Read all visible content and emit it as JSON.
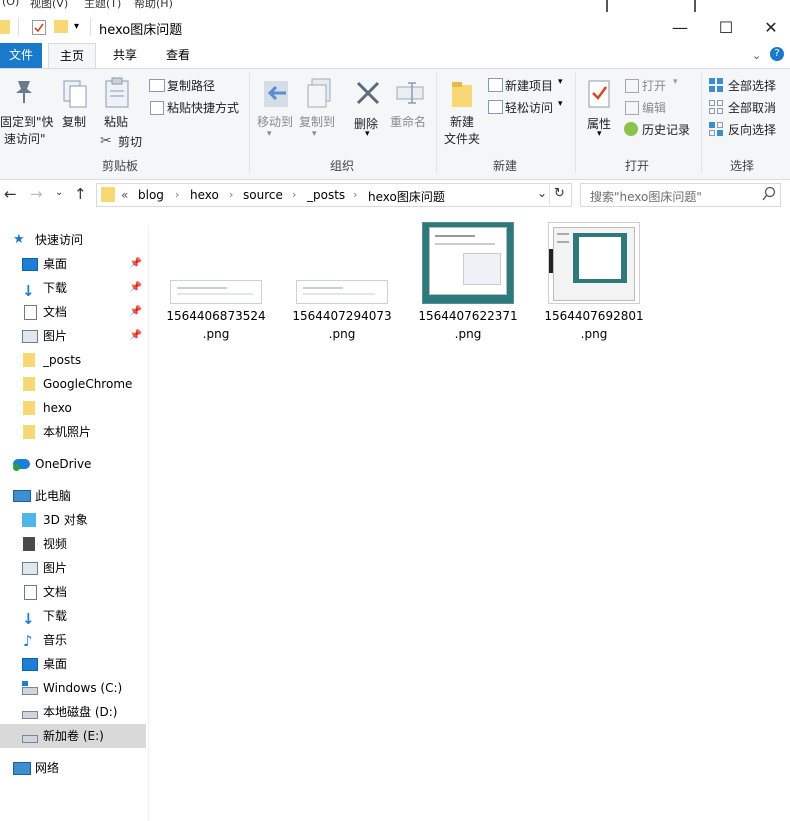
{
  "background_menu": {
    "items": [
      "(O)",
      "视图(V)",
      "主题(T)",
      "帮助(H)"
    ]
  },
  "title": "hexo图床问题",
  "window_buttons": {
    "minimize": "—",
    "maximize": "☐",
    "close": "✕"
  },
  "tabs": [
    "文件",
    "主页",
    "共享",
    "查看"
  ],
  "ribbon": {
    "clipboard": {
      "pin_label_1": "固定到\"快",
      "pin_label_2": "速访问\"",
      "copy": "复制",
      "paste": "粘贴",
      "copy_path": "复制路径",
      "paste_shortcut": "粘贴快捷方式",
      "cut": "剪切",
      "group": "剪贴板"
    },
    "organize": {
      "move_to": "移动到",
      "copy_to": "复制到",
      "delete": "删除",
      "rename": "重命名",
      "group": "组织"
    },
    "new": {
      "new_folder_1": "新建",
      "new_folder_2": "文件夹",
      "new_item": "新建项目",
      "easy_access": "轻松访问",
      "group": "新建"
    },
    "open": {
      "properties": "属性",
      "open": "打开",
      "edit": "编辑",
      "history": "历史记录",
      "group": "打开"
    },
    "select": {
      "select_all": "全部选择",
      "select_none": "全部取消",
      "invert": "反向选择",
      "group": "选择"
    }
  },
  "address": {
    "crumbs": [
      "«",
      "blog",
      "hexo",
      "source",
      "_posts",
      "hexo图床问题"
    ],
    "search_placeholder": "搜索\"hexo图床问题\""
  },
  "nav": {
    "quick_access": "快速访问",
    "quick_items": [
      "桌面",
      "下载",
      "文档",
      "图片",
      "_posts",
      "GoogleChrome",
      "hexo",
      "本机照片"
    ],
    "onedrive": "OneDrive",
    "this_pc": "此电脑",
    "pc_items": [
      "3D 对象",
      "视频",
      "图片",
      "文档",
      "下载",
      "音乐",
      "桌面",
      "Windows (C:)",
      "本地磁盘 (D:)",
      "新加卷 (E:)"
    ],
    "network": "网络"
  },
  "files": [
    {
      "name1": "1564406873524",
      "name2": ".png"
    },
    {
      "name1": "1564407294073",
      "name2": ".png"
    },
    {
      "name1": "1564407622371",
      "name2": ".png"
    },
    {
      "name1": "1564407692801",
      "name2": ".png"
    }
  ],
  "colors": {
    "accent": "#1979ca",
    "selected": "#e5f3ff",
    "selected_nav": "#d9d9d9",
    "folder": "#f8d775",
    "teal": "#2d7a7d"
  }
}
